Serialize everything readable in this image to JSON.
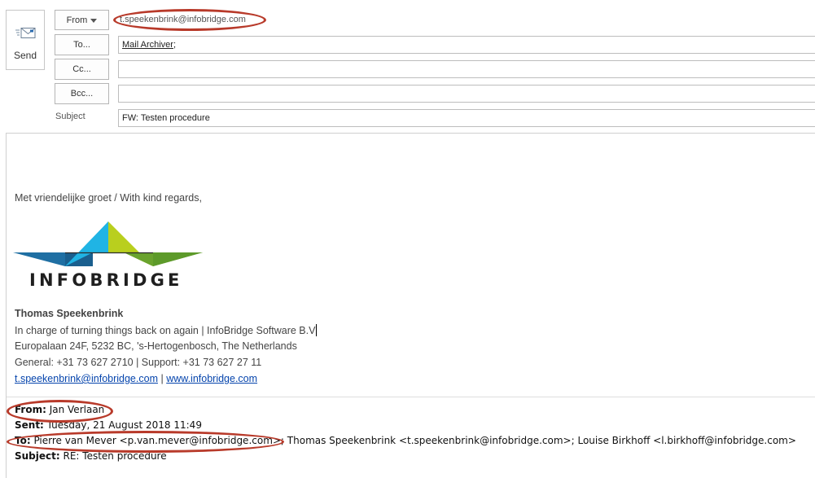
{
  "compose": {
    "send_label": "Send",
    "from_button": "From",
    "from_address": "t.speekenbrink@infobridge.com",
    "to_button": "To...",
    "to_recipient": "Mail Archiver",
    "to_separator": ";",
    "cc_button": "Cc...",
    "bcc_button": "Bcc...",
    "subject_label": "Subject",
    "subject_value": "FW: Testen procedure"
  },
  "body": {
    "closing": "Met vriendelijke groet / With kind regards,",
    "logo_text": "INFOBRIDGE",
    "signature": {
      "name": "Thomas Speekenbrink",
      "role": "In charge of turning things back on again | InfoBridge Software B.V",
      "address": "Europalaan 24F, 5232 BC, 's-Hertogenbosch, The Netherlands",
      "phones": "General: +31 73 627 2710 | Support: +31 73 627 27 11",
      "email": "t.speekenbrink@infobridge.com",
      "link_separator": " | ",
      "website": "www.infobridge.com"
    },
    "quoted": {
      "from_label": "From:",
      "from_value": " Jan Verlaan",
      "sent_label": "Sent:",
      "sent_value": " Tuesday, 21 August 2018 11:49",
      "to_label": "To:",
      "to_value": " Pierre van Mever <p.van.mever@infobridge.com>; Thomas Speekenbrink <t.speekenbrink@infobridge.com>; Louise Birkhoff <l.birkhoff@infobridge.com>",
      "subject_label": "Subject:",
      "subject_value": " RE: Testen procedure"
    }
  },
  "colors": {
    "annotation_red": "#b83a2a",
    "logo_dark_blue": "#1f6fa3",
    "logo_cyan": "#1fa8d8",
    "logo_yellow_green": "#b9cf1e",
    "logo_green": "#6aa32e",
    "link_blue": "#0645ad"
  }
}
